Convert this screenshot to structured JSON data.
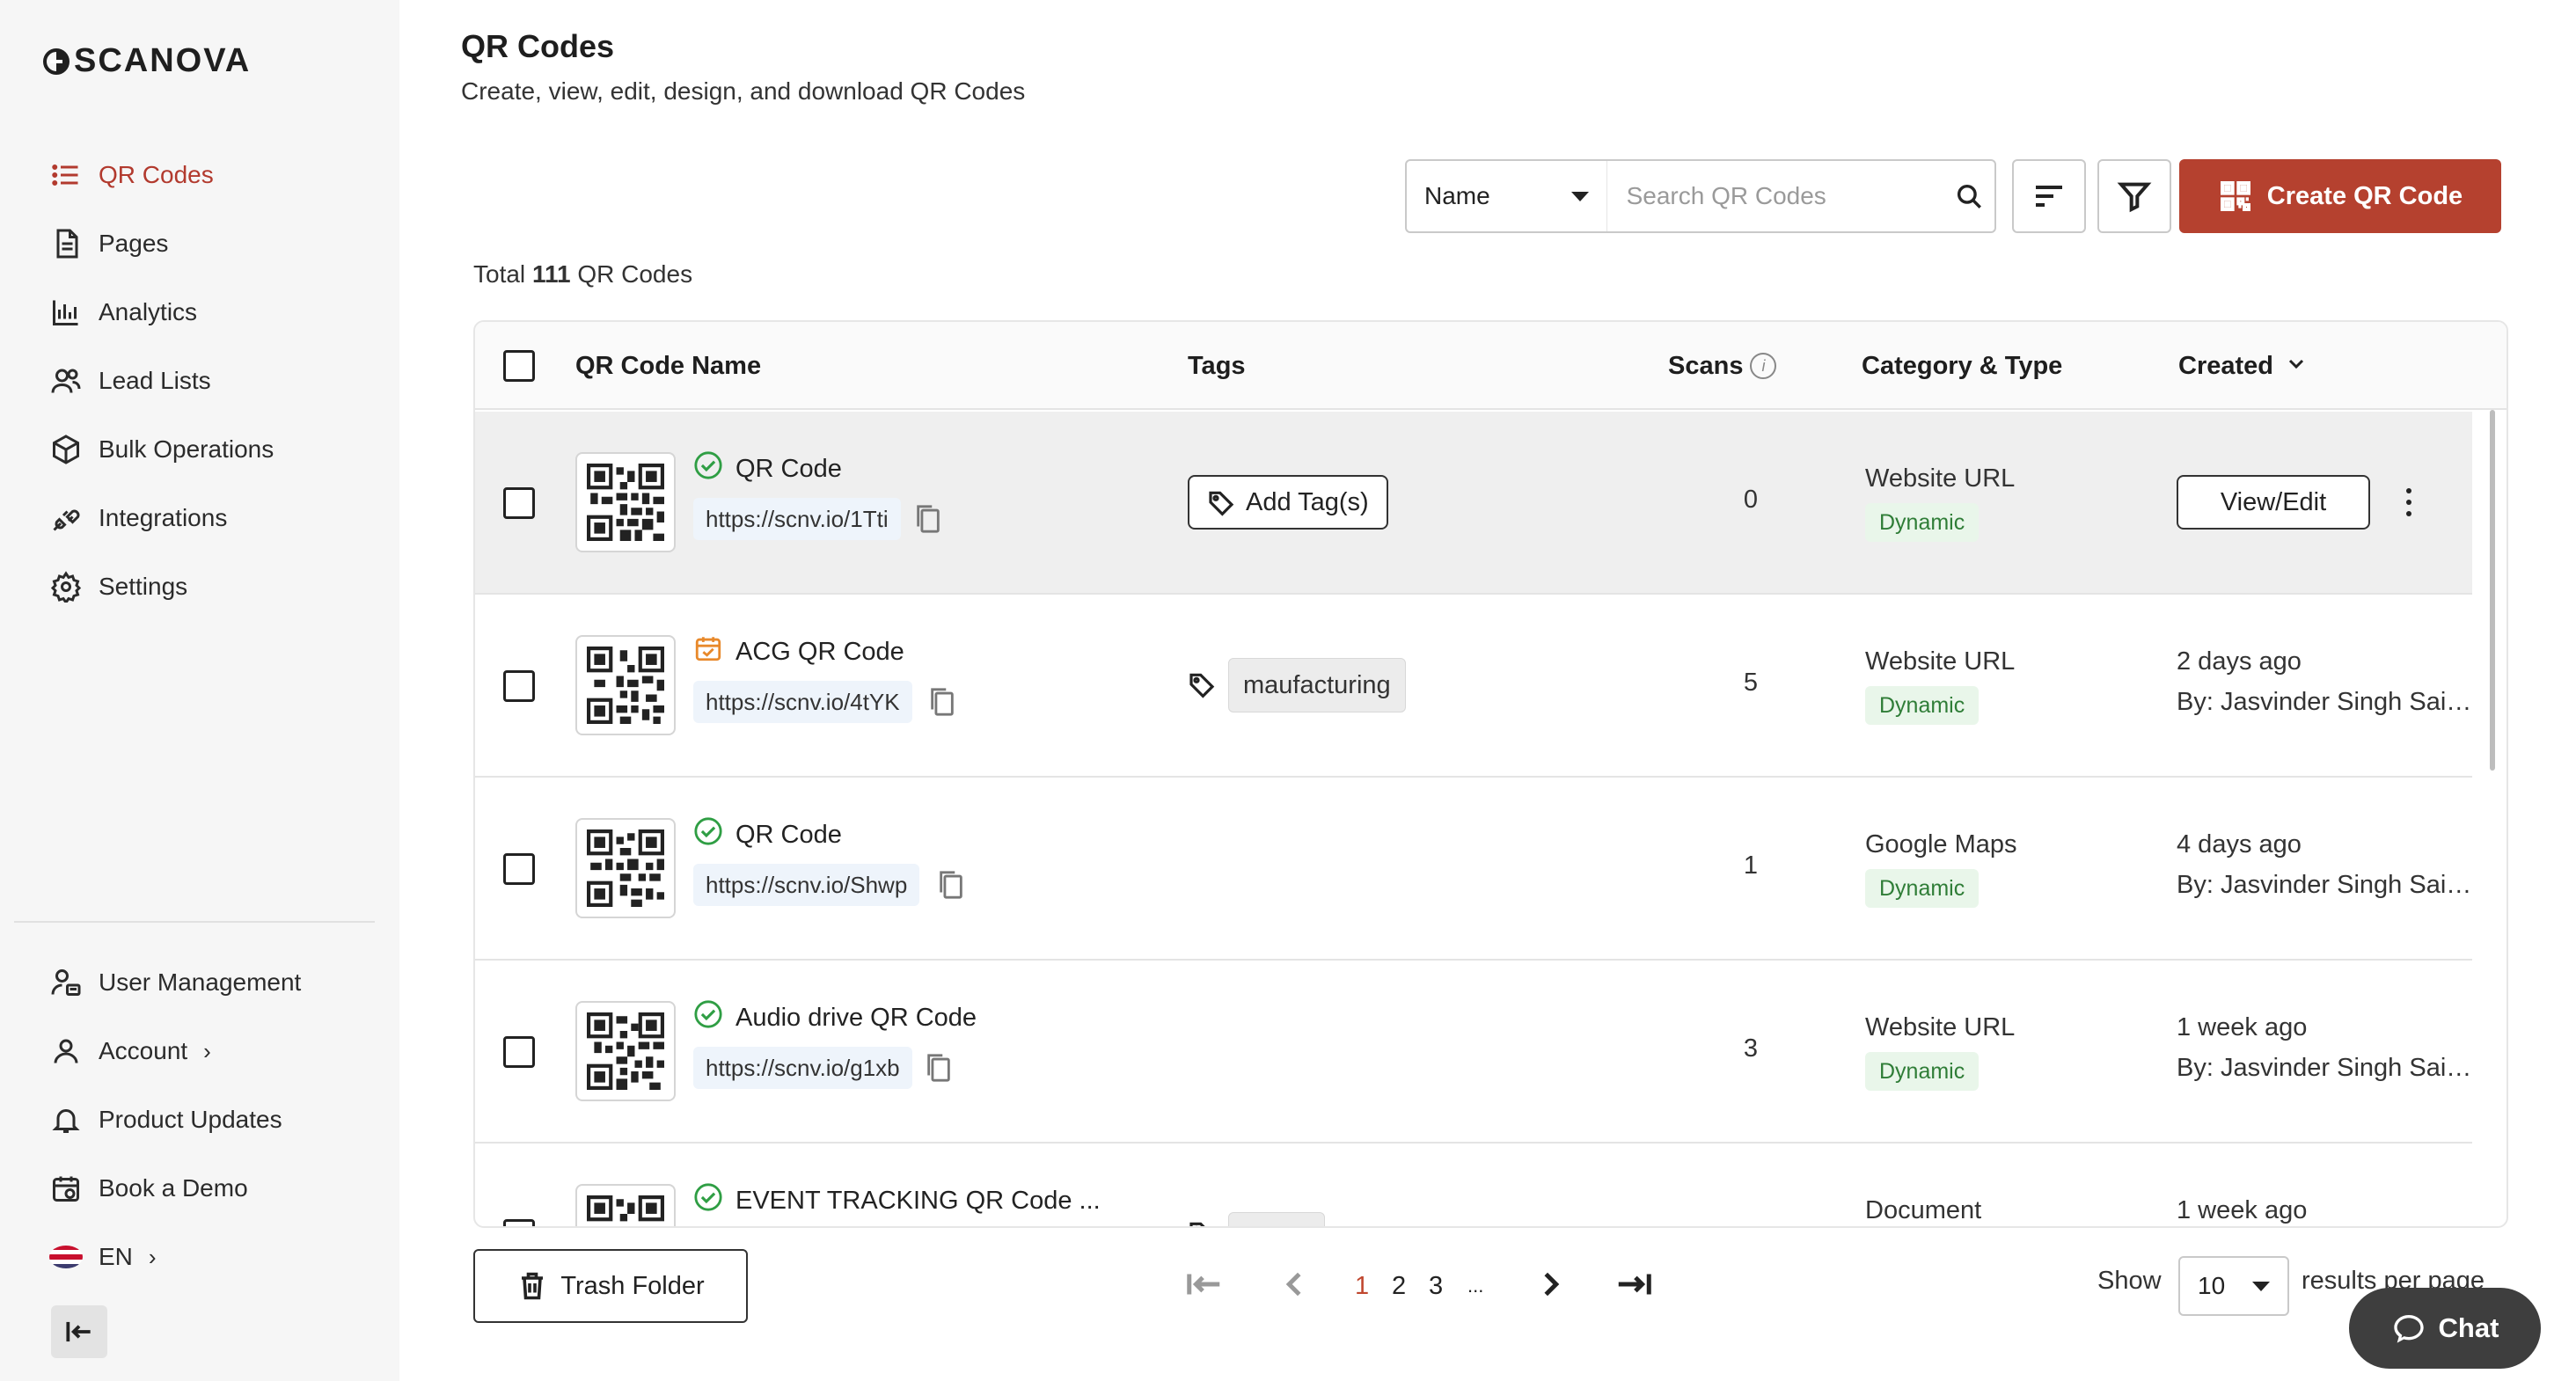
{
  "brand": {
    "name": "SCANOVA"
  },
  "sidebar": {
    "items": [
      {
        "label": "QR Codes",
        "icon": "list-icon",
        "active": true
      },
      {
        "label": "Pages",
        "icon": "page-icon"
      },
      {
        "label": "Analytics",
        "icon": "bar-chart-icon"
      },
      {
        "label": "Lead Lists",
        "icon": "users-icon"
      },
      {
        "label": "Bulk Operations",
        "icon": "cube-icon"
      },
      {
        "label": "Integrations",
        "icon": "plug-icon"
      },
      {
        "label": "Settings",
        "icon": "gear-icon"
      }
    ],
    "bottom": [
      {
        "label": "User Management",
        "icon": "user-management-icon"
      },
      {
        "label": "Account",
        "icon": "user-icon"
      },
      {
        "label": "Product Updates",
        "icon": "bell-icon"
      },
      {
        "label": "Book a Demo",
        "icon": "calendar-icon"
      },
      {
        "label": "EN",
        "icon": "us-flag-icon"
      }
    ]
  },
  "header": {
    "title": "QR Codes",
    "subtitle": "Create, view, edit, design, and download QR Codes"
  },
  "toolbar": {
    "search_field": "Name",
    "search_placeholder": "Search QR Codes",
    "create_label": "Create QR Code"
  },
  "summary": {
    "prefix": "Total",
    "count": "111",
    "suffix": "QR Codes"
  },
  "table": {
    "columns": {
      "name": "QR Code Name",
      "tags": "Tags",
      "scans": "Scans",
      "category": "Category & Type",
      "created": "Created"
    },
    "rows": [
      {
        "name": "QR Code",
        "status": "active",
        "url": "https://scnv.io/1Tti",
        "tag_action": "Add Tag(s)",
        "tag": "",
        "scans": "0",
        "category": "Website URL",
        "type": "Dynamic",
        "created": "",
        "created_by": "",
        "action": "View/Edit"
      },
      {
        "name": "ACG QR Code",
        "status": "scheduled",
        "url": "https://scnv.io/4tYK",
        "tag_action": "",
        "tag": "maufacturing",
        "scans": "5",
        "category": "Website URL",
        "type": "Dynamic",
        "created": "2 days ago",
        "created_by": "By: Jasvinder Singh Saini ...",
        "action": ""
      },
      {
        "name": "QR Code",
        "status": "active",
        "url": "https://scnv.io/Shwp",
        "tag_action": "",
        "tag": "",
        "scans": "1",
        "category": "Google Maps",
        "type": "Dynamic",
        "created": "4 days ago",
        "created_by": "By: Jasvinder Singh Saini ...",
        "action": ""
      },
      {
        "name": "Audio drive QR Code",
        "status": "active",
        "url": "https://scnv.io/g1xb",
        "tag_action": "",
        "tag": "",
        "scans": "3",
        "category": "Website URL",
        "type": "Dynamic",
        "created": "1 week ago",
        "created_by": "By: Jasvinder Singh Saini ...",
        "action": ""
      },
      {
        "name": "EVENT TRACKING QR Code ...",
        "status": "active",
        "url": "",
        "tag_action": "",
        "tag": "",
        "scans": "",
        "category": "Document",
        "type": "",
        "created": "1 week ago",
        "created_by": "",
        "action": ""
      }
    ]
  },
  "footer": {
    "trash_label": "Trash Folder",
    "pages": [
      "1",
      "2",
      "3",
      "..."
    ],
    "current_page": "1",
    "show_label": "Show",
    "page_size": "10",
    "per_page_label": "results per page"
  },
  "chat": {
    "label": "Chat"
  },
  "colors": {
    "accent": "#b5412f",
    "active_status": "#2f9e44",
    "scheduled_status": "#e8892b",
    "type_pill_bg": "#e9f6ea"
  }
}
